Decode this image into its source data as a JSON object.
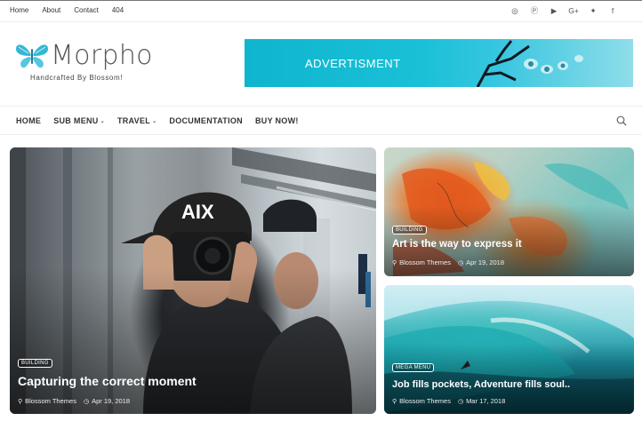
{
  "topbar": {
    "links": [
      "Home",
      "About",
      "Contact",
      "404"
    ],
    "social_icons": [
      "instagram-icon",
      "pinterest-icon",
      "youtube-icon",
      "google-plus-icon",
      "twitter-icon",
      "facebook-icon"
    ],
    "social_glyphs": [
      "◎",
      "Ⓟ",
      "▶",
      "G+",
      "✦",
      "f"
    ]
  },
  "header": {
    "site_title": "Morpho",
    "tagline": "Handcrafted By Blossom!",
    "ad_text": "ADVERTISMENT",
    "brand_color": "#2bb3d6"
  },
  "nav": {
    "items": [
      "HOME",
      "SUB MENU",
      "TRAVEL",
      "DOCUMENTATION",
      "BUY NOW!"
    ],
    "dropdown_caret": "⌄"
  },
  "posts": [
    {
      "category": "BUILDING",
      "title": "Capturing the correct moment",
      "author": "Blossom Themes",
      "date": "Apr 19, 2018"
    },
    {
      "category": "BUILDING",
      "title": "Art is the way to express it",
      "author": "Blossom Themes",
      "date": "Apr 19, 2018"
    },
    {
      "category": "MEGA MENU",
      "title": "Job fills pockets, Adventure fills soul..",
      "author": "Blossom Themes",
      "date": "Mar 17, 2018"
    }
  ]
}
